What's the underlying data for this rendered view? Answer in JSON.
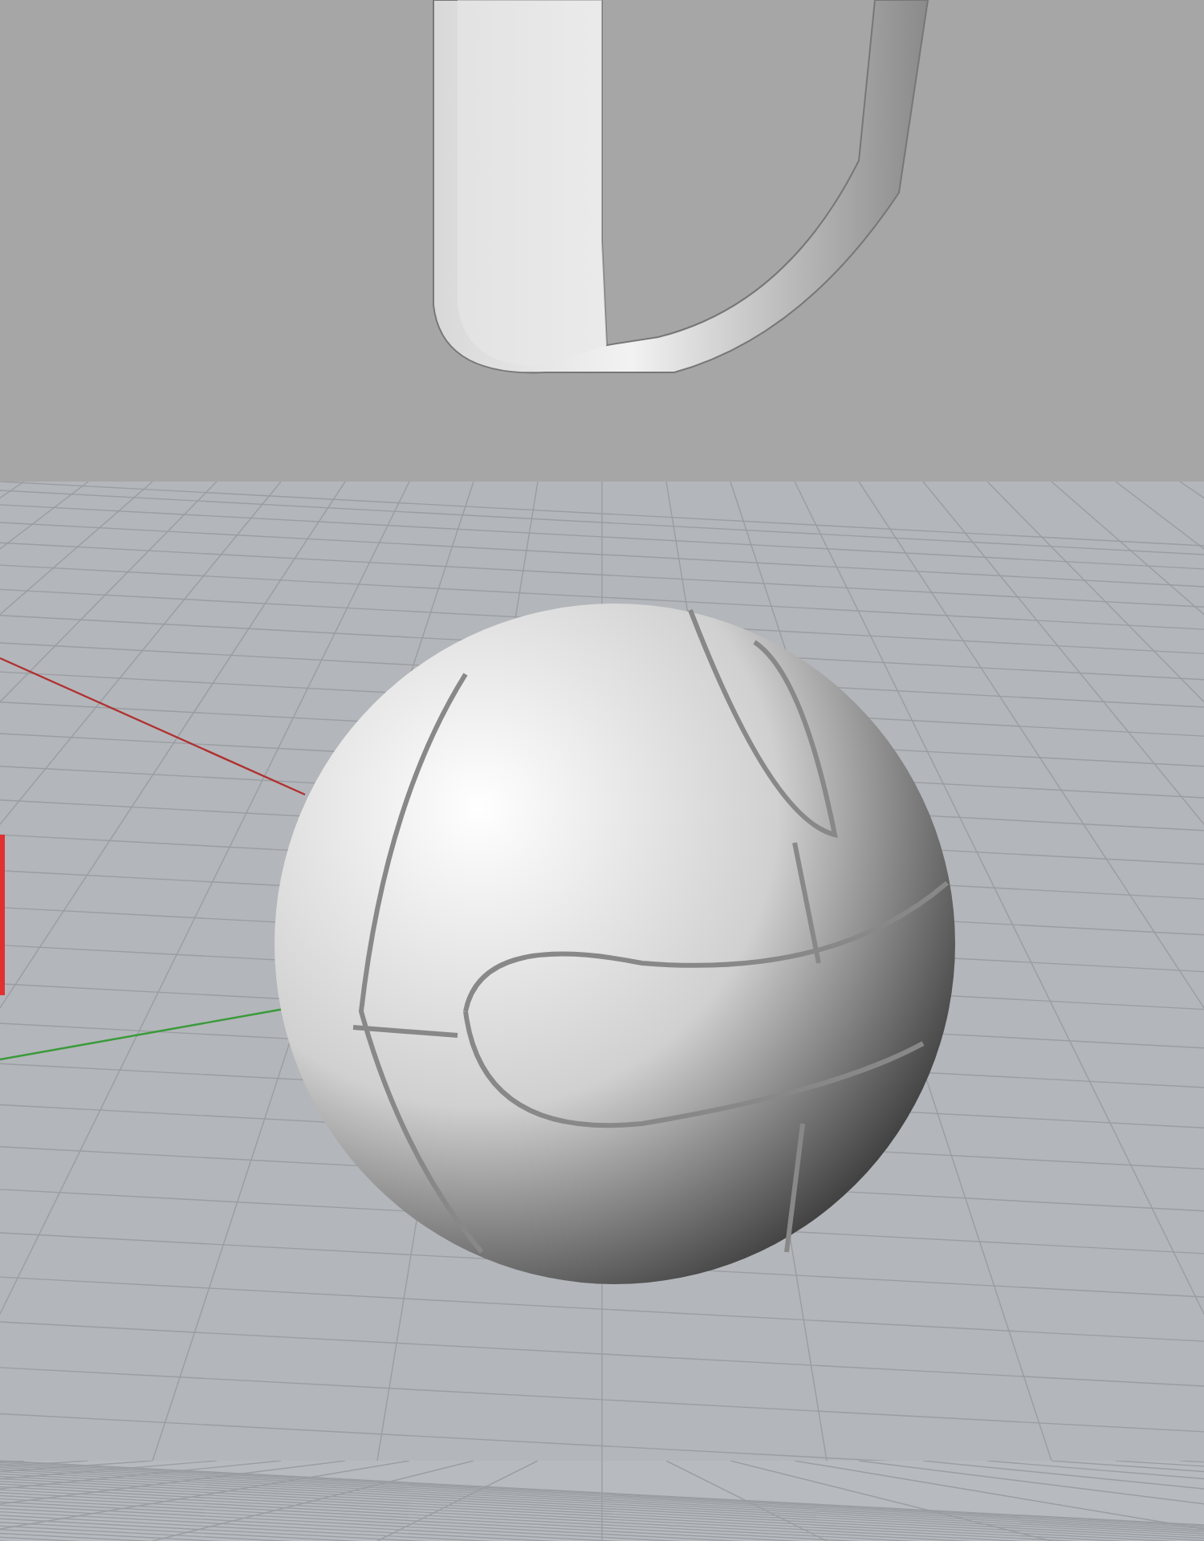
{
  "viewports": [
    {
      "kind": "shaded"
    },
    {
      "kind": "grid"
    },
    {
      "kind": "grid-strip"
    }
  ]
}
